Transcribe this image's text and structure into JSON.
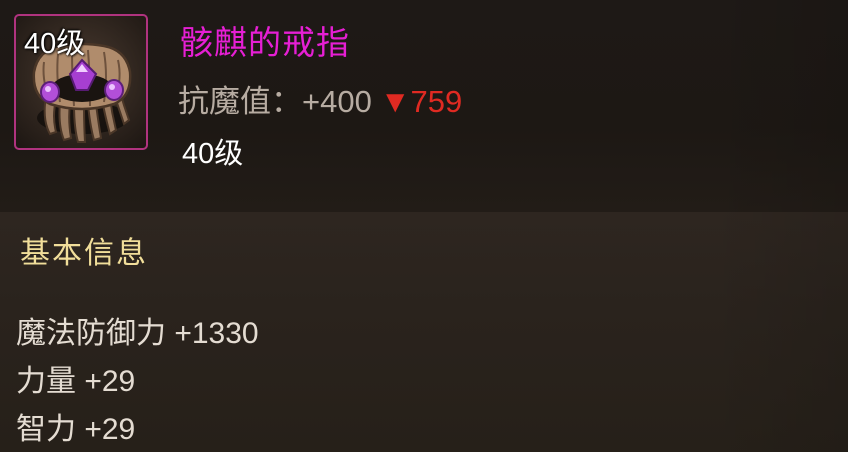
{
  "item": {
    "level_badge": "40级",
    "name": "骸麒的戒指",
    "icon": "ring-icon",
    "rarity_color": "#e61fd4",
    "stat": {
      "label": "抗魔值：",
      "value": "+400",
      "compare_arrow": "▼",
      "compare_value": "759",
      "compare_color": "#e02a22"
    },
    "required_level": "40级"
  },
  "basic_info": {
    "title": "基本信息",
    "attributes": [
      "魔法防御力 +1330",
      "力量 +29",
      "智力 +29"
    ]
  }
}
